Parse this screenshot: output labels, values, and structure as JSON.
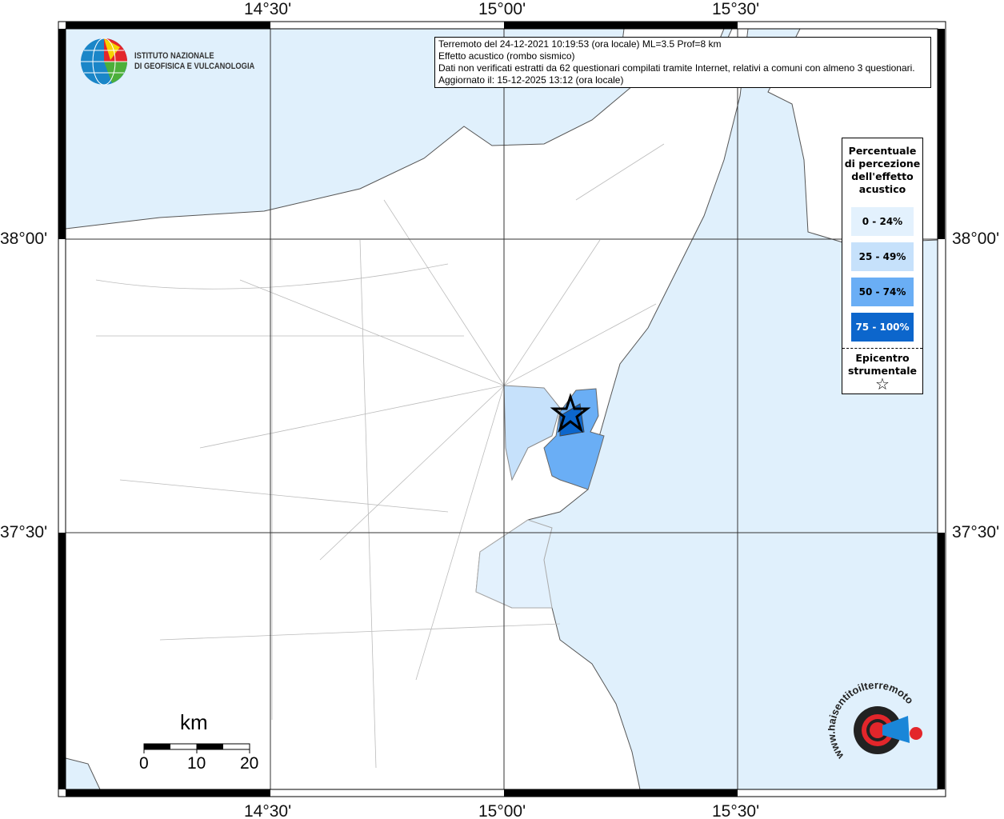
{
  "title_box": {
    "lines": [
      "Terremoto del 24-12-2021 10:19:53 (ora locale) ML=3.5 Prof=8 km",
      "Effetto acustico (rombo sismico)",
      "Dati non verificati estratti da 62 questionari compilati tramite Internet, relativi a comuni con almeno 3 questionari.",
      "Aggiornato il: 15-12-2025 13:12 (ora locale)"
    ]
  },
  "logo": {
    "line1": "ISTITUTO NAZIONALE",
    "line2": "DI GEOFISICA E VULCANOLOGIA"
  },
  "axes": {
    "lon": [
      "14°30'",
      "15°00'",
      "15°30'"
    ],
    "lat": [
      "38°00'",
      "37°30'"
    ]
  },
  "legend": {
    "title": "Percentuale di percezione dell'effetto acustico",
    "items": [
      {
        "label": "0 - 24%",
        "color": "#e3f1fd"
      },
      {
        "label": "25 - 49%",
        "color": "#c6e1fb"
      },
      {
        "label": "50 - 74%",
        "color": "#6aaef5"
      },
      {
        "label": "75 - 100%",
        "color": "#0c66cc"
      }
    ],
    "epicenter": "Epicentro strumentale",
    "epicenter_icon": "star-icon"
  },
  "scale": {
    "unit": "km",
    "ticks": [
      "0",
      "10",
      "20"
    ]
  },
  "watermark": "www.haisentitoilterremoto.it",
  "colors": {
    "sea": "#e0f0fc",
    "land": "#ffffff"
  }
}
